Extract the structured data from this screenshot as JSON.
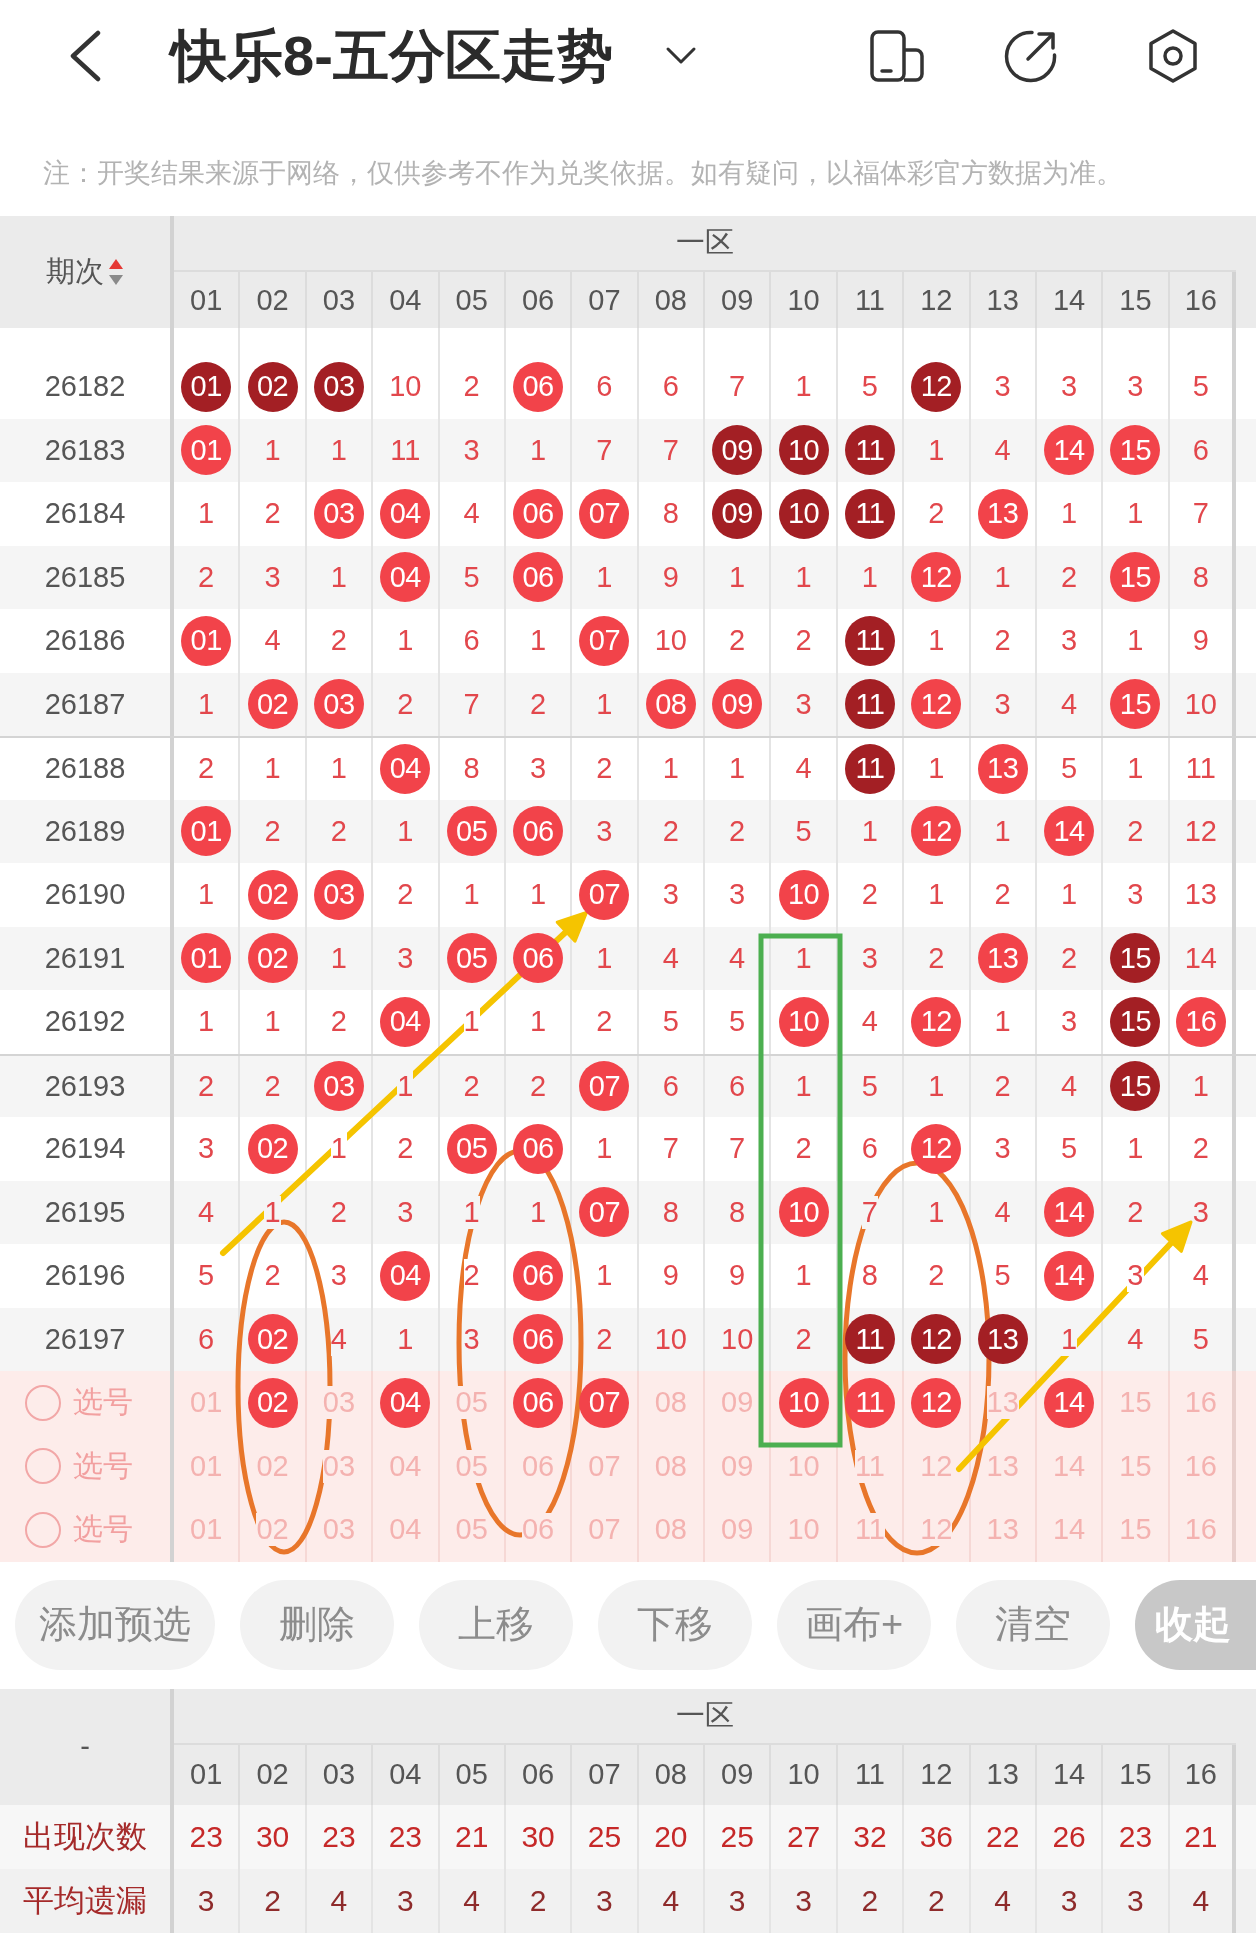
{
  "header": {
    "title": "快乐8-五分区走势"
  },
  "notice": "注：开奖结果来源于网络，仅供参考不作为兑奖依据。如有疑问，以福体彩官方数据为准。",
  "trend_table": {
    "issue_heading": "期次",
    "ascending": true,
    "zone_label": "一区",
    "columns": [
      "01",
      "02",
      "03",
      "04",
      "05",
      "06",
      "07",
      "08",
      "09",
      "10",
      "11",
      "12",
      "13",
      "14",
      "15",
      "16"
    ],
    "rows": [
      {
        "issue": "26182",
        "cells": [
          {
            "text": "01",
            "hit": true,
            "color": "#a31f24"
          },
          {
            "text": "02",
            "hit": true,
            "color": "#a31f24"
          },
          {
            "text": "03",
            "hit": true,
            "color": "#a31f24"
          },
          {
            "text": "10",
            "hit": false
          },
          {
            "text": "2",
            "hit": false
          },
          {
            "text": "06",
            "hit": true,
            "color": "#f2434a"
          },
          {
            "text": "6",
            "hit": false
          },
          {
            "text": "6",
            "hit": false
          },
          {
            "text": "7",
            "hit": false
          },
          {
            "text": "1",
            "hit": false
          },
          {
            "text": "5",
            "hit": false
          },
          {
            "text": "12",
            "hit": true,
            "color": "#a31f24"
          },
          {
            "text": "3",
            "hit": false
          },
          {
            "text": "3",
            "hit": false
          },
          {
            "text": "3",
            "hit": false
          },
          {
            "text": "5",
            "hit": false
          }
        ]
      },
      {
        "issue": "26183",
        "cells": [
          {
            "text": "01",
            "hit": true,
            "color": "#f2434a"
          },
          {
            "text": "1",
            "hit": false
          },
          {
            "text": "1",
            "hit": false
          },
          {
            "text": "11",
            "hit": false
          },
          {
            "text": "3",
            "hit": false
          },
          {
            "text": "1",
            "hit": false
          },
          {
            "text": "7",
            "hit": false
          },
          {
            "text": "7",
            "hit": false
          },
          {
            "text": "09",
            "hit": true,
            "color": "#a31f24"
          },
          {
            "text": "10",
            "hit": true,
            "color": "#a31f24"
          },
          {
            "text": "11",
            "hit": true,
            "color": "#a31f24"
          },
          {
            "text": "1",
            "hit": false
          },
          {
            "text": "4",
            "hit": false
          },
          {
            "text": "14",
            "hit": true,
            "color": "#f2434a"
          },
          {
            "text": "15",
            "hit": true,
            "color": "#f2434a"
          },
          {
            "text": "6",
            "hit": false
          }
        ]
      },
      {
        "issue": "26184",
        "cells": [
          {
            "text": "1",
            "hit": false
          },
          {
            "text": "2",
            "hit": false
          },
          {
            "text": "03",
            "hit": true,
            "color": "#f2434a"
          },
          {
            "text": "04",
            "hit": true,
            "color": "#f2434a"
          },
          {
            "text": "4",
            "hit": false
          },
          {
            "text": "06",
            "hit": true,
            "color": "#f2434a"
          },
          {
            "text": "07",
            "hit": true,
            "color": "#f2434a"
          },
          {
            "text": "8",
            "hit": false
          },
          {
            "text": "09",
            "hit": true,
            "color": "#a31f24"
          },
          {
            "text": "10",
            "hit": true,
            "color": "#a31f24"
          },
          {
            "text": "11",
            "hit": true,
            "color": "#a31f24"
          },
          {
            "text": "2",
            "hit": false
          },
          {
            "text": "13",
            "hit": true,
            "color": "#f2434a"
          },
          {
            "text": "1",
            "hit": false
          },
          {
            "text": "1",
            "hit": false
          },
          {
            "text": "7",
            "hit": false
          }
        ]
      },
      {
        "issue": "26185",
        "cells": [
          {
            "text": "2",
            "hit": false
          },
          {
            "text": "3",
            "hit": false
          },
          {
            "text": "1",
            "hit": false
          },
          {
            "text": "04",
            "hit": true,
            "color": "#f2434a"
          },
          {
            "text": "5",
            "hit": false
          },
          {
            "text": "06",
            "hit": true,
            "color": "#f2434a"
          },
          {
            "text": "1",
            "hit": false
          },
          {
            "text": "9",
            "hit": false
          },
          {
            "text": "1",
            "hit": false
          },
          {
            "text": "1",
            "hit": false
          },
          {
            "text": "1",
            "hit": false
          },
          {
            "text": "12",
            "hit": true,
            "color": "#f2434a"
          },
          {
            "text": "1",
            "hit": false
          },
          {
            "text": "2",
            "hit": false
          },
          {
            "text": "15",
            "hit": true,
            "color": "#f2434a"
          },
          {
            "text": "8",
            "hit": false
          }
        ]
      },
      {
        "issue": "26186",
        "cells": [
          {
            "text": "01",
            "hit": true,
            "color": "#f2434a"
          },
          {
            "text": "4",
            "hit": false
          },
          {
            "text": "2",
            "hit": false
          },
          {
            "text": "1",
            "hit": false
          },
          {
            "text": "6",
            "hit": false
          },
          {
            "text": "1",
            "hit": false
          },
          {
            "text": "07",
            "hit": true,
            "color": "#f2434a"
          },
          {
            "text": "10",
            "hit": false
          },
          {
            "text": "2",
            "hit": false
          },
          {
            "text": "2",
            "hit": false
          },
          {
            "text": "11",
            "hit": true,
            "color": "#a31f24"
          },
          {
            "text": "1",
            "hit": false
          },
          {
            "text": "2",
            "hit": false
          },
          {
            "text": "3",
            "hit": false
          },
          {
            "text": "1",
            "hit": false
          },
          {
            "text": "9",
            "hit": false
          }
        ]
      },
      {
        "issue": "26187",
        "cells": [
          {
            "text": "1",
            "hit": false
          },
          {
            "text": "02",
            "hit": true,
            "color": "#f2434a"
          },
          {
            "text": "03",
            "hit": true,
            "color": "#f2434a"
          },
          {
            "text": "2",
            "hit": false
          },
          {
            "text": "7",
            "hit": false
          },
          {
            "text": "2",
            "hit": false
          },
          {
            "text": "1",
            "hit": false
          },
          {
            "text": "08",
            "hit": true,
            "color": "#f2434a"
          },
          {
            "text": "09",
            "hit": true,
            "color": "#f2434a"
          },
          {
            "text": "3",
            "hit": false
          },
          {
            "text": "11",
            "hit": true,
            "color": "#a31f24"
          },
          {
            "text": "12",
            "hit": true,
            "color": "#f2434a"
          },
          {
            "text": "3",
            "hit": false
          },
          {
            "text": "4",
            "hit": false
          },
          {
            "text": "15",
            "hit": true,
            "color": "#f2434a"
          },
          {
            "text": "10",
            "hit": false
          }
        ]
      },
      {
        "issue": "26188",
        "cells": [
          {
            "text": "2",
            "hit": false
          },
          {
            "text": "1",
            "hit": false
          },
          {
            "text": "1",
            "hit": false
          },
          {
            "text": "04",
            "hit": true,
            "color": "#f2434a"
          },
          {
            "text": "8",
            "hit": false
          },
          {
            "text": "3",
            "hit": false
          },
          {
            "text": "2",
            "hit": false
          },
          {
            "text": "1",
            "hit": false
          },
          {
            "text": "1",
            "hit": false
          },
          {
            "text": "4",
            "hit": false
          },
          {
            "text": "11",
            "hit": true,
            "color": "#a31f24"
          },
          {
            "text": "1",
            "hit": false
          },
          {
            "text": "13",
            "hit": true,
            "color": "#f2434a"
          },
          {
            "text": "5",
            "hit": false
          },
          {
            "text": "1",
            "hit": false
          },
          {
            "text": "11",
            "hit": false
          }
        ]
      },
      {
        "issue": "26189",
        "cells": [
          {
            "text": "01",
            "hit": true,
            "color": "#f2434a"
          },
          {
            "text": "2",
            "hit": false
          },
          {
            "text": "2",
            "hit": false
          },
          {
            "text": "1",
            "hit": false
          },
          {
            "text": "05",
            "hit": true,
            "color": "#f2434a"
          },
          {
            "text": "06",
            "hit": true,
            "color": "#f2434a"
          },
          {
            "text": "3",
            "hit": false
          },
          {
            "text": "2",
            "hit": false
          },
          {
            "text": "2",
            "hit": false
          },
          {
            "text": "5",
            "hit": false
          },
          {
            "text": "1",
            "hit": false
          },
          {
            "text": "12",
            "hit": true,
            "color": "#f2434a"
          },
          {
            "text": "1",
            "hit": false
          },
          {
            "text": "14",
            "hit": true,
            "color": "#f2434a"
          },
          {
            "text": "2",
            "hit": false
          },
          {
            "text": "12",
            "hit": false
          }
        ]
      },
      {
        "issue": "26190",
        "cells": [
          {
            "text": "1",
            "hit": false
          },
          {
            "text": "02",
            "hit": true,
            "color": "#f2434a"
          },
          {
            "text": "03",
            "hit": true,
            "color": "#f2434a"
          },
          {
            "text": "2",
            "hit": false
          },
          {
            "text": "1",
            "hit": false
          },
          {
            "text": "1",
            "hit": false
          },
          {
            "text": "07",
            "hit": true,
            "color": "#f2434a"
          },
          {
            "text": "3",
            "hit": false
          },
          {
            "text": "3",
            "hit": false
          },
          {
            "text": "10",
            "hit": true,
            "color": "#f2434a"
          },
          {
            "text": "2",
            "hit": false
          },
          {
            "text": "1",
            "hit": false
          },
          {
            "text": "2",
            "hit": false
          },
          {
            "text": "1",
            "hit": false
          },
          {
            "text": "3",
            "hit": false
          },
          {
            "text": "13",
            "hit": false
          }
        ]
      },
      {
        "issue": "26191",
        "cells": [
          {
            "text": "01",
            "hit": true,
            "color": "#f2434a"
          },
          {
            "text": "02",
            "hit": true,
            "color": "#f2434a"
          },
          {
            "text": "1",
            "hit": false
          },
          {
            "text": "3",
            "hit": false
          },
          {
            "text": "05",
            "hit": true,
            "color": "#f2434a"
          },
          {
            "text": "06",
            "hit": true,
            "color": "#f2434a"
          },
          {
            "text": "1",
            "hit": false
          },
          {
            "text": "4",
            "hit": false
          },
          {
            "text": "4",
            "hit": false
          },
          {
            "text": "1",
            "hit": false
          },
          {
            "text": "3",
            "hit": false
          },
          {
            "text": "2",
            "hit": false
          },
          {
            "text": "13",
            "hit": true,
            "color": "#f2434a"
          },
          {
            "text": "2",
            "hit": false
          },
          {
            "text": "15",
            "hit": true,
            "color": "#a31f24"
          },
          {
            "text": "14",
            "hit": false
          }
        ]
      },
      {
        "issue": "26192",
        "cells": [
          {
            "text": "1",
            "hit": false
          },
          {
            "text": "1",
            "hit": false
          },
          {
            "text": "2",
            "hit": false
          },
          {
            "text": "04",
            "hit": true,
            "color": "#f2434a"
          },
          {
            "text": "1",
            "hit": false
          },
          {
            "text": "1",
            "hit": false
          },
          {
            "text": "2",
            "hit": false
          },
          {
            "text": "5",
            "hit": false
          },
          {
            "text": "5",
            "hit": false
          },
          {
            "text": "10",
            "hit": true,
            "color": "#f2434a"
          },
          {
            "text": "4",
            "hit": false
          },
          {
            "text": "12",
            "hit": true,
            "color": "#f2434a"
          },
          {
            "text": "1",
            "hit": false
          },
          {
            "text": "3",
            "hit": false
          },
          {
            "text": "15",
            "hit": true,
            "color": "#a31f24"
          },
          {
            "text": "16",
            "hit": true,
            "color": "#f2434a"
          }
        ]
      },
      {
        "issue": "26193",
        "cells": [
          {
            "text": "2",
            "hit": false
          },
          {
            "text": "2",
            "hit": false
          },
          {
            "text": "03",
            "hit": true,
            "color": "#f2434a"
          },
          {
            "text": "1",
            "hit": false
          },
          {
            "text": "2",
            "hit": false
          },
          {
            "text": "2",
            "hit": false
          },
          {
            "text": "07",
            "hit": true,
            "color": "#f2434a"
          },
          {
            "text": "6",
            "hit": false
          },
          {
            "text": "6",
            "hit": false
          },
          {
            "text": "1",
            "hit": false
          },
          {
            "text": "5",
            "hit": false
          },
          {
            "text": "1",
            "hit": false
          },
          {
            "text": "2",
            "hit": false
          },
          {
            "text": "4",
            "hit": false
          },
          {
            "text": "15",
            "hit": true,
            "color": "#a31f24"
          },
          {
            "text": "1",
            "hit": false
          }
        ]
      },
      {
        "issue": "26194",
        "cells": [
          {
            "text": "3",
            "hit": false
          },
          {
            "text": "02",
            "hit": true,
            "color": "#f2434a"
          },
          {
            "text": "1",
            "hit": false
          },
          {
            "text": "2",
            "hit": false
          },
          {
            "text": "05",
            "hit": true,
            "color": "#f2434a"
          },
          {
            "text": "06",
            "hit": true,
            "color": "#f2434a"
          },
          {
            "text": "1",
            "hit": false
          },
          {
            "text": "7",
            "hit": false
          },
          {
            "text": "7",
            "hit": false
          },
          {
            "text": "2",
            "hit": false
          },
          {
            "text": "6",
            "hit": false
          },
          {
            "text": "12",
            "hit": true,
            "color": "#f2434a"
          },
          {
            "text": "3",
            "hit": false
          },
          {
            "text": "5",
            "hit": false
          },
          {
            "text": "1",
            "hit": false
          },
          {
            "text": "2",
            "hit": false
          }
        ]
      },
      {
        "issue": "26195",
        "cells": [
          {
            "text": "4",
            "hit": false
          },
          {
            "text": "1",
            "hit": false
          },
          {
            "text": "2",
            "hit": false
          },
          {
            "text": "3",
            "hit": false
          },
          {
            "text": "1",
            "hit": false
          },
          {
            "text": "1",
            "hit": false
          },
          {
            "text": "07",
            "hit": true,
            "color": "#f2434a"
          },
          {
            "text": "8",
            "hit": false
          },
          {
            "text": "8",
            "hit": false
          },
          {
            "text": "10",
            "hit": true,
            "color": "#f2434a"
          },
          {
            "text": "7",
            "hit": false
          },
          {
            "text": "1",
            "hit": false
          },
          {
            "text": "4",
            "hit": false
          },
          {
            "text": "14",
            "hit": true,
            "color": "#f2434a"
          },
          {
            "text": "2",
            "hit": false
          },
          {
            "text": "3",
            "hit": false
          }
        ]
      },
      {
        "issue": "26196",
        "cells": [
          {
            "text": "5",
            "hit": false
          },
          {
            "text": "2",
            "hit": false
          },
          {
            "text": "3",
            "hit": false
          },
          {
            "text": "04",
            "hit": true,
            "color": "#f2434a"
          },
          {
            "text": "2",
            "hit": false
          },
          {
            "text": "06",
            "hit": true,
            "color": "#f2434a"
          },
          {
            "text": "1",
            "hit": false
          },
          {
            "text": "9",
            "hit": false
          },
          {
            "text": "9",
            "hit": false
          },
          {
            "text": "1",
            "hit": false
          },
          {
            "text": "8",
            "hit": false
          },
          {
            "text": "2",
            "hit": false
          },
          {
            "text": "5",
            "hit": false
          },
          {
            "text": "14",
            "hit": true,
            "color": "#f2434a"
          },
          {
            "text": "3",
            "hit": false
          },
          {
            "text": "4",
            "hit": false
          }
        ]
      },
      {
        "issue": "26197",
        "cells": [
          {
            "text": "6",
            "hit": false
          },
          {
            "text": "02",
            "hit": true,
            "color": "#f2434a"
          },
          {
            "text": "4",
            "hit": false
          },
          {
            "text": "1",
            "hit": false
          },
          {
            "text": "3",
            "hit": false
          },
          {
            "text": "06",
            "hit": true,
            "color": "#f2434a"
          },
          {
            "text": "2",
            "hit": false
          },
          {
            "text": "10",
            "hit": false
          },
          {
            "text": "10",
            "hit": false
          },
          {
            "text": "2",
            "hit": false
          },
          {
            "text": "11",
            "hit": true,
            "color": "#a31f24"
          },
          {
            "text": "12",
            "hit": true,
            "color": "#a31f24"
          },
          {
            "text": "13",
            "hit": true,
            "color": "#a31f24"
          },
          {
            "text": "1",
            "hit": false
          },
          {
            "text": "4",
            "hit": false
          },
          {
            "text": "5",
            "hit": false
          }
        ]
      }
    ]
  },
  "pick_rows": [
    {
      "label": "选号",
      "checked": false,
      "numbers": [
        {
          "text": "01",
          "selected": false
        },
        {
          "text": "02",
          "selected": true
        },
        {
          "text": "03",
          "selected": false
        },
        {
          "text": "04",
          "selected": true
        },
        {
          "text": "05",
          "selected": false
        },
        {
          "text": "06",
          "selected": true
        },
        {
          "text": "07",
          "selected": true
        },
        {
          "text": "08",
          "selected": false
        },
        {
          "text": "09",
          "selected": false
        },
        {
          "text": "10",
          "selected": true
        },
        {
          "text": "11",
          "selected": true
        },
        {
          "text": "12",
          "selected": true
        },
        {
          "text": "13",
          "selected": false
        },
        {
          "text": "14",
          "selected": true
        },
        {
          "text": "15",
          "selected": false
        },
        {
          "text": "16",
          "selected": false
        }
      ]
    },
    {
      "label": "选号",
      "checked": false,
      "numbers": [
        {
          "text": "01",
          "selected": false
        },
        {
          "text": "02",
          "selected": false
        },
        {
          "text": "03",
          "selected": false
        },
        {
          "text": "04",
          "selected": false
        },
        {
          "text": "05",
          "selected": false
        },
        {
          "text": "06",
          "selected": false
        },
        {
          "text": "07",
          "selected": false
        },
        {
          "text": "08",
          "selected": false
        },
        {
          "text": "09",
          "selected": false
        },
        {
          "text": "10",
          "selected": false
        },
        {
          "text": "11",
          "selected": false
        },
        {
          "text": "12",
          "selected": false
        },
        {
          "text": "13",
          "selected": false
        },
        {
          "text": "14",
          "selected": false
        },
        {
          "text": "15",
          "selected": false
        },
        {
          "text": "16",
          "selected": false
        }
      ]
    },
    {
      "label": "选号",
      "checked": false,
      "numbers": [
        {
          "text": "01",
          "selected": false
        },
        {
          "text": "02",
          "selected": false
        },
        {
          "text": "03",
          "selected": false
        },
        {
          "text": "04",
          "selected": false
        },
        {
          "text": "05",
          "selected": false
        },
        {
          "text": "06",
          "selected": false
        },
        {
          "text": "07",
          "selected": false
        },
        {
          "text": "08",
          "selected": false
        },
        {
          "text": "09",
          "selected": false
        },
        {
          "text": "10",
          "selected": false
        },
        {
          "text": "11",
          "selected": false
        },
        {
          "text": "12",
          "selected": false
        },
        {
          "text": "13",
          "selected": false
        },
        {
          "text": "14",
          "selected": false
        },
        {
          "text": "15",
          "selected": false
        },
        {
          "text": "16",
          "selected": false
        }
      ]
    }
  ],
  "buttons": [
    {
      "label": "添加预选",
      "kind": "plain"
    },
    {
      "label": "删除",
      "kind": "plain"
    },
    {
      "label": "上移",
      "kind": "plain"
    },
    {
      "label": "下移",
      "kind": "plain"
    },
    {
      "label": "画布+",
      "kind": "plain"
    },
    {
      "label": "清空",
      "kind": "plain"
    },
    {
      "label": "收起",
      "kind": "filled"
    }
  ],
  "stats_table": {
    "corner": "-",
    "zone_label": "一区",
    "columns": [
      "01",
      "02",
      "03",
      "04",
      "05",
      "06",
      "07",
      "08",
      "09",
      "10",
      "11",
      "12",
      "13",
      "14",
      "15",
      "16"
    ],
    "rows": [
      {
        "label": "出现次数",
        "kind": "count",
        "values": [
          "23",
          "30",
          "23",
          "23",
          "21",
          "30",
          "25",
          "20",
          "25",
          "27",
          "32",
          "36",
          "22",
          "26",
          "23",
          "21"
        ]
      },
      {
        "label": "平均遗漏",
        "kind": "average",
        "values": [
          "3",
          "2",
          "4",
          "3",
          "4",
          "2",
          "3",
          "4",
          "3",
          "3",
          "2",
          "2",
          "4",
          "3",
          "3",
          "4"
        ]
      }
    ]
  }
}
